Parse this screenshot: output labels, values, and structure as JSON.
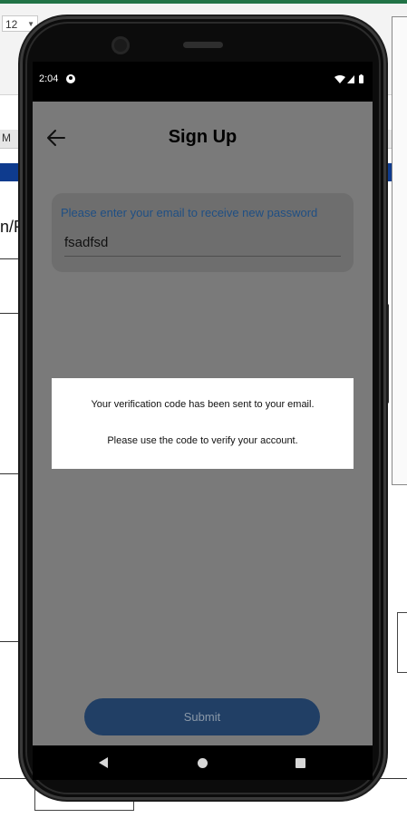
{
  "background_window": {
    "font_size_value": "12",
    "column_letter": "M",
    "cell_text": "n/R"
  },
  "status_bar": {
    "time": "2:04"
  },
  "header": {
    "title": "Sign Up",
    "back_icon": "arrow-left-icon"
  },
  "email_field": {
    "label": "Please enter your email to receive new password",
    "value": "fsadfsd"
  },
  "dialog": {
    "line1": "Your verification code has been sent to your email.",
    "line2": "Please use the code to verify your account."
  },
  "submit": {
    "label": "Submit"
  },
  "navigation": {
    "back_icon": "triangle-back-icon",
    "home_icon": "circle-home-icon",
    "recents_icon": "square-recents-icon"
  },
  "colors": {
    "accent_label": "#1f4f84",
    "button": "#213f65",
    "scrim": "#7a7a7a"
  }
}
